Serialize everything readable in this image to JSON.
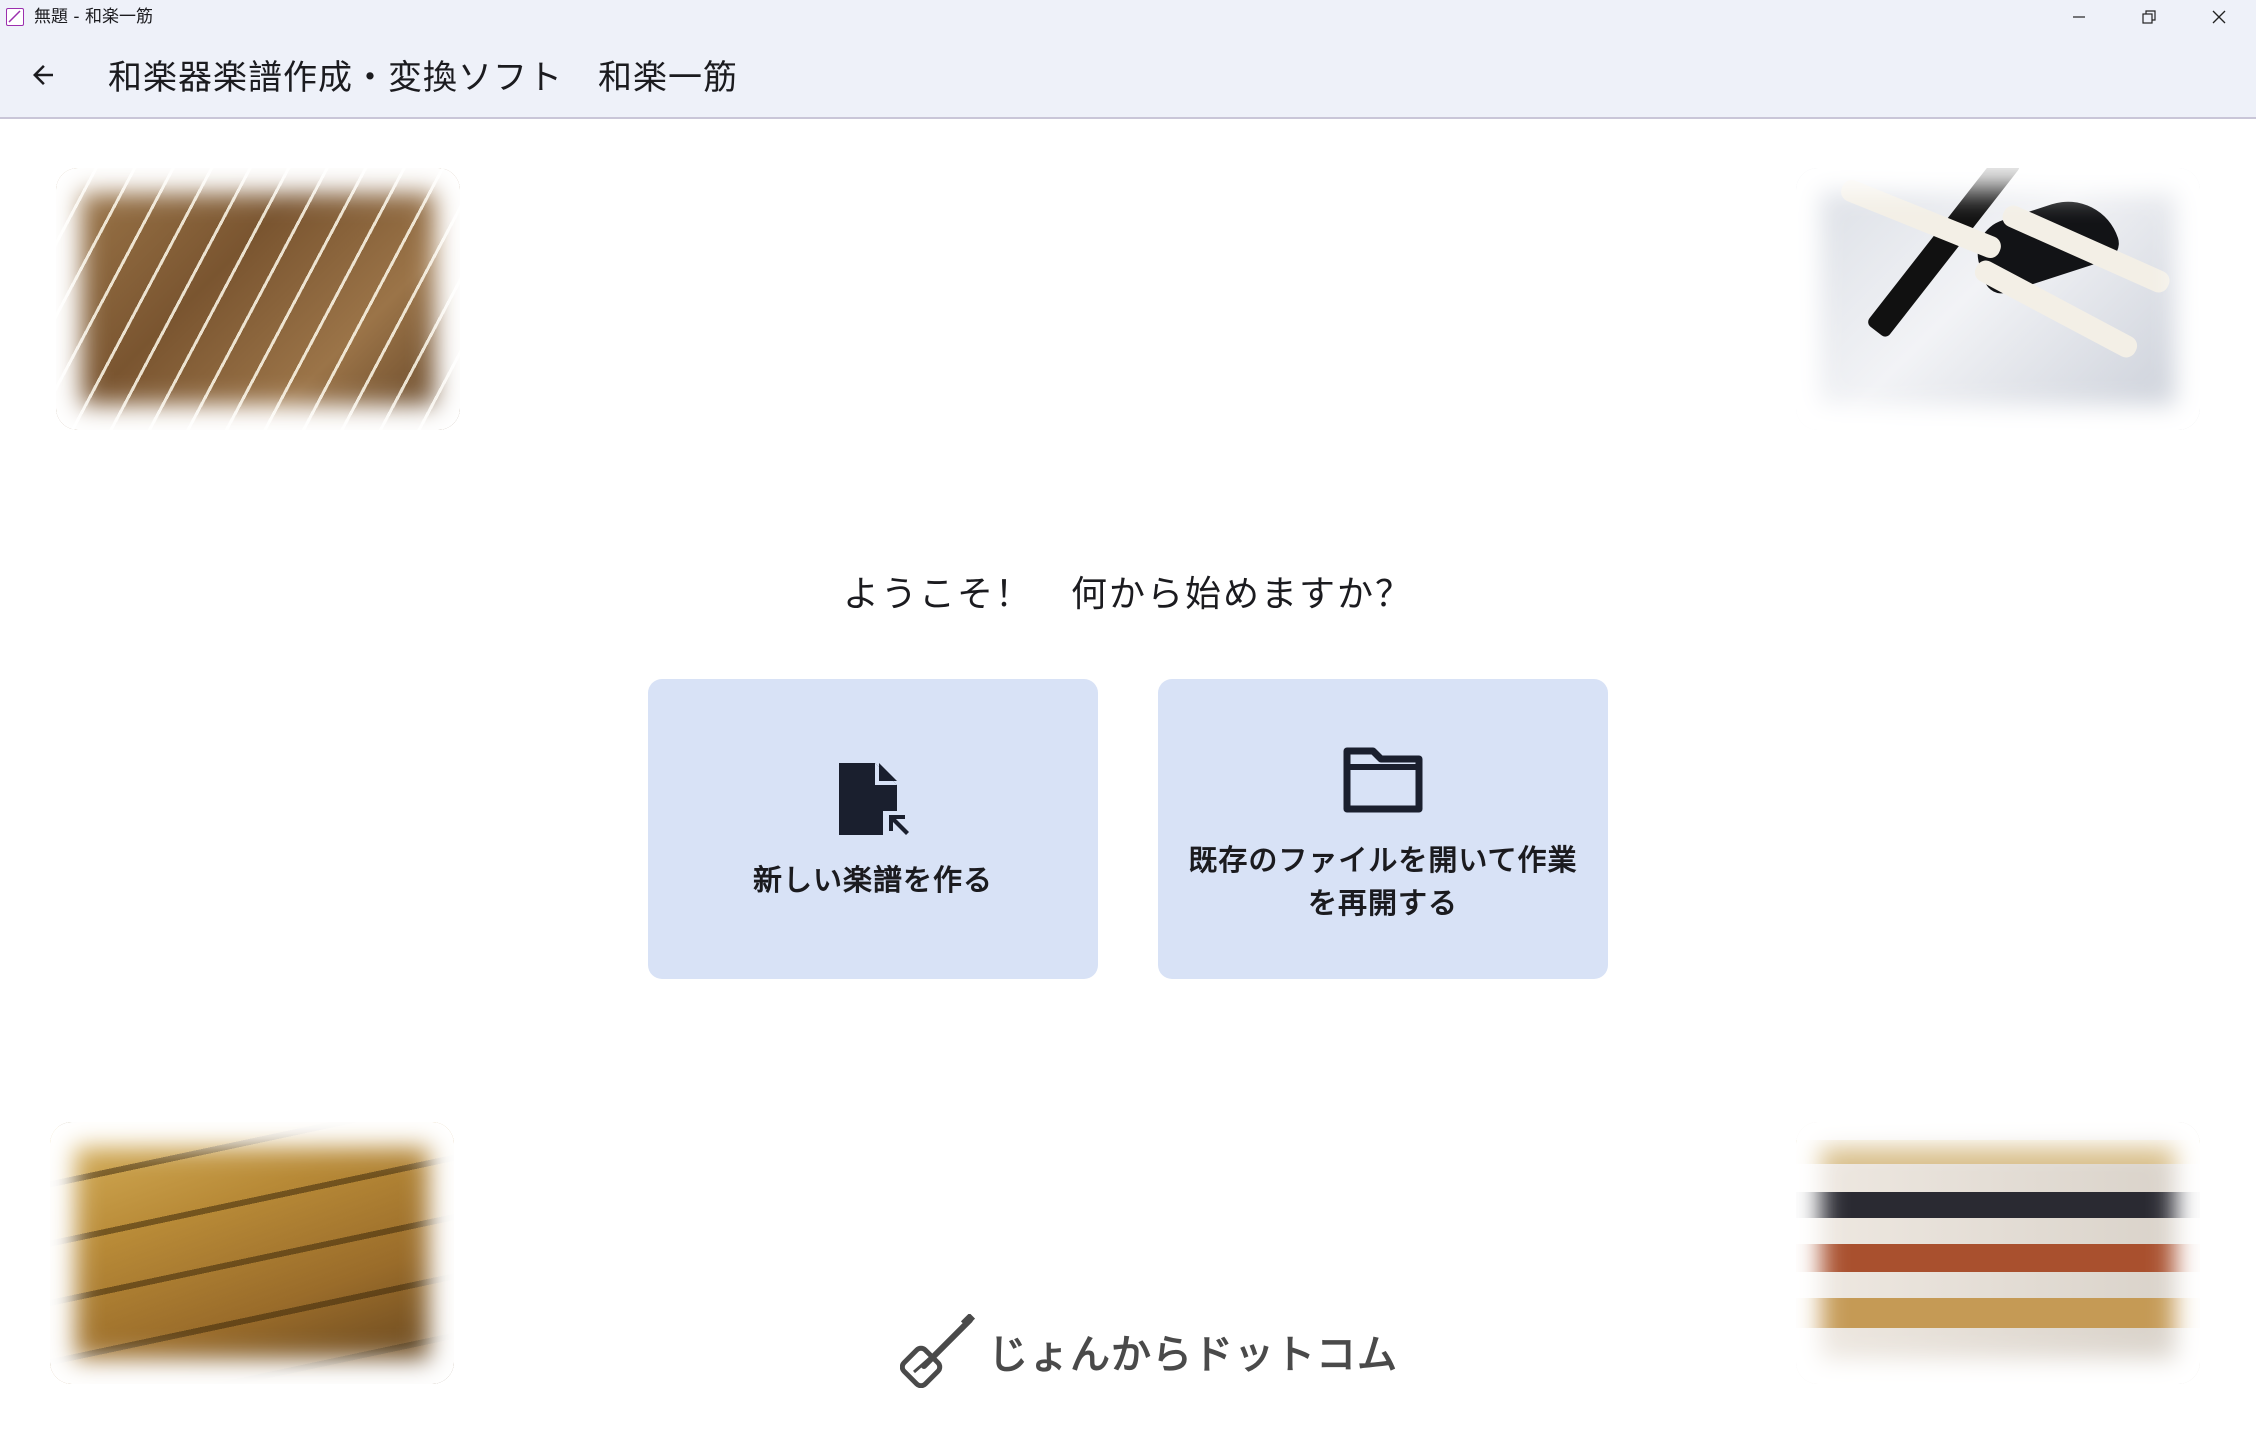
{
  "window": {
    "title": "無題 - 和楽一筋",
    "minimize_glyph": "—",
    "maximize_glyph": "❐",
    "close_glyph": "✕"
  },
  "appbar": {
    "title": "和楽器楽譜作成・変換ソフト　和楽一筋",
    "back_icon": "arrow-back-icon"
  },
  "welcome": {
    "message": "ようこそ！　何から始めますか？"
  },
  "actions": {
    "new_score": {
      "label": "新しい楽譜を作る",
      "icon": "new-file-icon"
    },
    "open_file": {
      "label": "既存のファイルを開いて作業を再開する",
      "icon": "folder-icon"
    }
  },
  "photos": {
    "top_left": "koto",
    "top_right": "shamisen",
    "bottom_left": "shakuhachi",
    "bottom_right": "fue"
  },
  "footer": {
    "logo_text": "じょんからドットコム",
    "logo_icon": "shamisen-logo-icon"
  },
  "colors": {
    "appbar_bg": "#eef1f9",
    "card_bg": "#d8e2f6",
    "text": "#1b1b1f",
    "icon": "#1a1f2e"
  }
}
